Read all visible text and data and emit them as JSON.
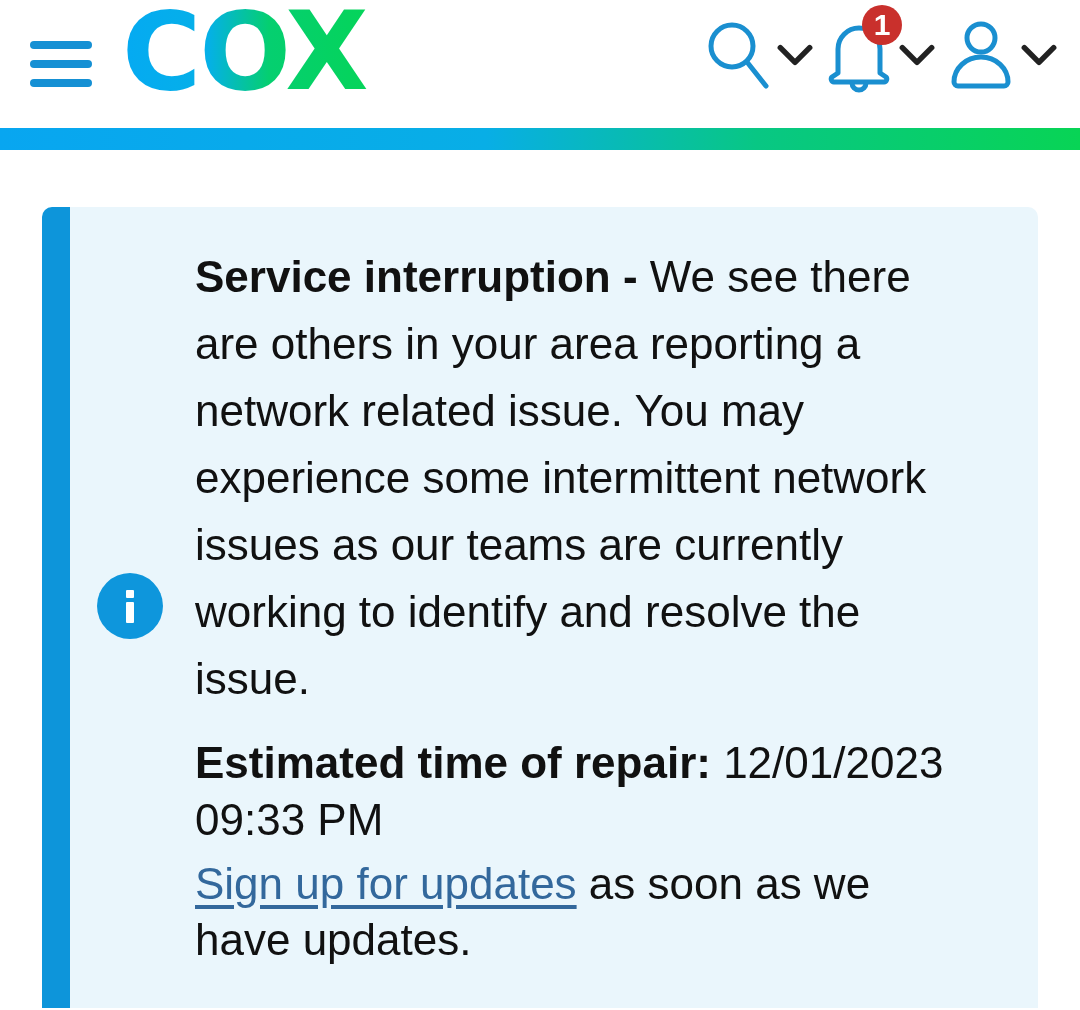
{
  "header": {
    "logo": "COX",
    "actions": [
      {
        "kind": "search"
      },
      {
        "kind": "notifications",
        "badge": "1"
      },
      {
        "kind": "account"
      }
    ]
  },
  "alert": {
    "kind": "info",
    "message": "**Service interruption -** We see there are others in your area reporting a network related issue. You may experience some intermittent network issues as our teams are currently working to identify and resolve the issue.",
    "eta": "**Estimated time of repair:** 12/01/2023 09:33 PM",
    "link": "Sign up for updates",
    "link_suffix": "as soon as we have updates."
  }
}
